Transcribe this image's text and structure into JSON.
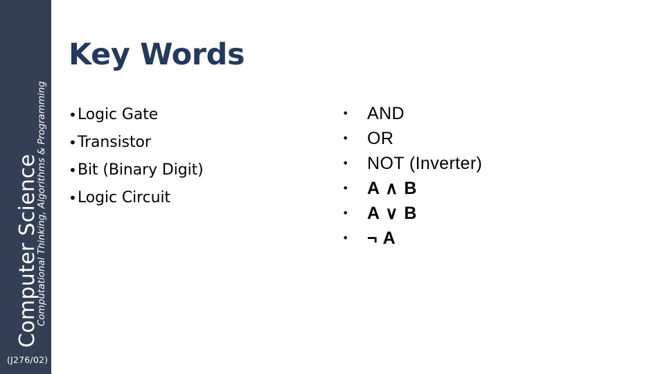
{
  "slide": {
    "title": "Key Words",
    "title_color": "#23395d",
    "background_color": "#ffffff"
  },
  "sidebar": {
    "background_color": "#333f54",
    "text_color": "#ffffff",
    "brand_title": "Computer Science",
    "brand_subtitle": "Computational Thinking, Algorithms & Programming",
    "spec_code": "(J276/02)"
  },
  "left_column": {
    "bullet_marker": "•",
    "items": [
      {
        "label": "Logic Gate"
      },
      {
        "label": "Transistor"
      },
      {
        "label": "Bit (Binary Digit)"
      },
      {
        "label": "Logic Circuit"
      }
    ]
  },
  "right_column": {
    "bullet_marker": "•",
    "items": [
      {
        "label": "AND",
        "style": "plain"
      },
      {
        "label": "OR",
        "style": "plain"
      },
      {
        "label": "NOT (Inverter)",
        "style": "plain"
      },
      {
        "label": "A ∧ B",
        "style": "logic"
      },
      {
        "label": "A ∨ B",
        "style": "logic"
      },
      {
        "label": "¬ A",
        "style": "logic"
      }
    ]
  }
}
